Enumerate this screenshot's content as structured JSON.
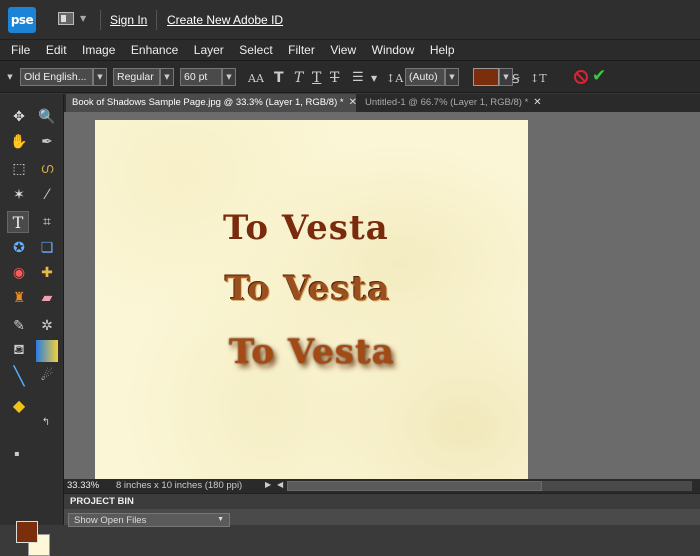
{
  "appbar": {
    "logo": "pse",
    "sign_in": "Sign In",
    "create_id": "Create New Adobe ID"
  },
  "menu": [
    "File",
    "Edit",
    "Image",
    "Enhance",
    "Layer",
    "Select",
    "Filter",
    "View",
    "Window",
    "Help"
  ],
  "options": {
    "font_family": "Old English...",
    "font_style": "Regular",
    "font_size": "60 pt",
    "leading": "(Auto)",
    "text_color": "#7a2e0c"
  },
  "tabs": [
    {
      "label": "Book of Shadows Sample Page.jpg @ 33.3% (Layer 1, RGB/8) *"
    },
    {
      "label": "Untitled-1 @ 66.7% (Layer 1, RGB/8) *"
    }
  ],
  "canvas": {
    "lines": [
      "To Vesta",
      "To Vesta",
      "To Vesta"
    ]
  },
  "status": {
    "zoom": "33.33%",
    "doc_size": "8 inches x 10 inches (180 ppi)"
  },
  "project_bin": {
    "title": "PROJECT BIN",
    "show_files": "Show Open Files"
  },
  "colors": {
    "foreground": "#7a2e0c",
    "background": "#fff8d8"
  }
}
